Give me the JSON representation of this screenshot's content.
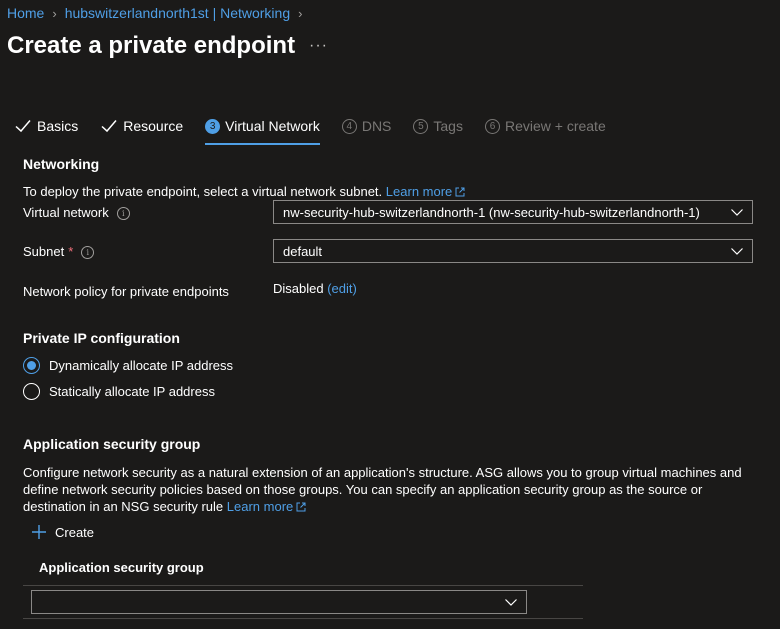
{
  "breadcrumb": [
    {
      "label": "Home"
    },
    {
      "label": "hubswitzerlandnorth1st | Networking"
    }
  ],
  "page_title": "Create a private endpoint",
  "more_label": "···",
  "tabs": [
    {
      "label": "Basics",
      "state": "done"
    },
    {
      "label": "Resource",
      "state": "done"
    },
    {
      "num": "3",
      "label": "Virtual Network",
      "state": "active"
    },
    {
      "num": "4",
      "label": "DNS",
      "state": "disabled"
    },
    {
      "num": "5",
      "label": "Tags",
      "state": "disabled"
    },
    {
      "num": "6",
      "label": "Review + create",
      "state": "disabled"
    }
  ],
  "networking": {
    "heading": "Networking",
    "description": "To deploy the private endpoint, select a virtual network subnet.",
    "learn_more": "Learn more",
    "vnet_label": "Virtual network",
    "vnet_value": "nw-security-hub-switzerlandnorth-1 (nw-security-hub-switzerlandnorth-1)",
    "subnet_label": "Subnet",
    "required_mark": "*",
    "subnet_value": "default",
    "policy_label": "Network policy for private endpoints",
    "policy_value": "Disabled",
    "policy_edit": "(edit)"
  },
  "private_ip": {
    "heading": "Private IP configuration",
    "options": [
      {
        "label": "Dynamically allocate IP address",
        "selected": true
      },
      {
        "label": "Statically allocate IP address",
        "selected": false
      }
    ]
  },
  "asg": {
    "heading": "Application security group",
    "description": "Configure network security as a natural extension of an application's structure. ASG allows you to group virtual machines and define network security policies based on those groups. You can specify an application security group as the source or destination in an NSG security rule",
    "learn_more": "Learn more",
    "create_label": "Create",
    "column_header": "Application security group",
    "select_value": ""
  },
  "icons": {
    "check": "checkmark-icon",
    "info": "info-icon",
    "external": "external-link-icon",
    "chevron": "chevron-down-icon",
    "plus": "plus-icon"
  },
  "colors": {
    "background": "#1b1a19",
    "accent": "#4f9fe6",
    "required": "#f1707b",
    "disabled": "#797775"
  }
}
